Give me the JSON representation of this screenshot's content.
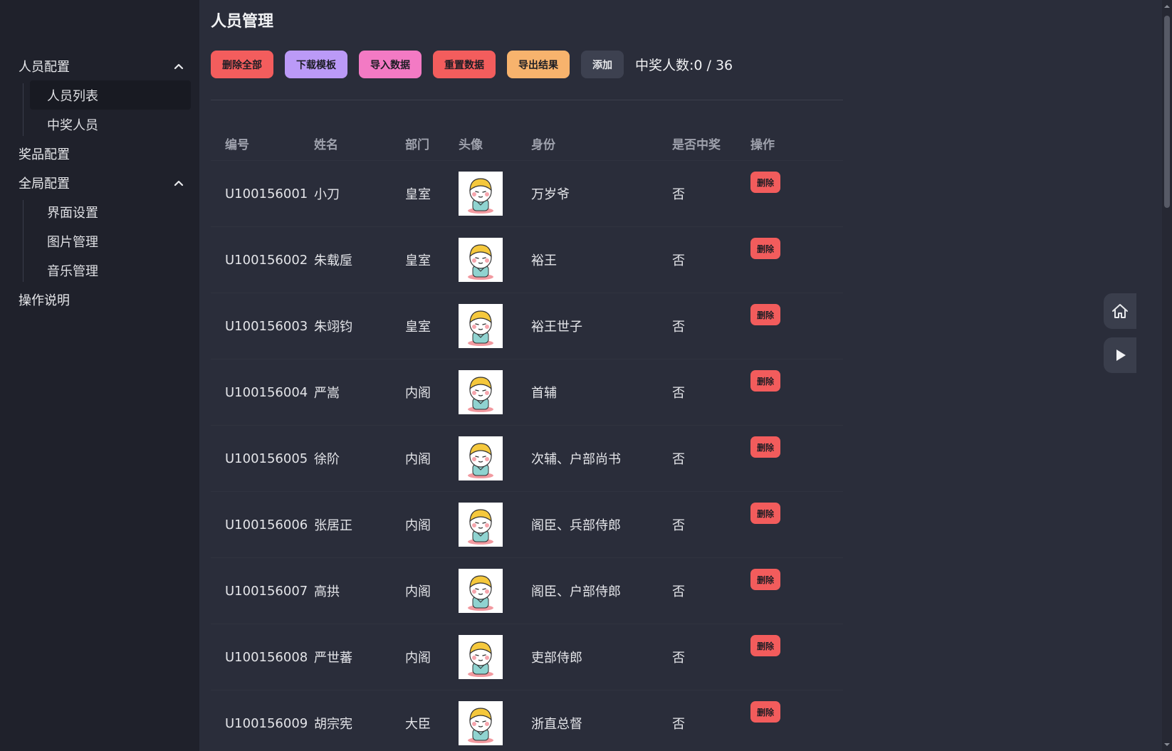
{
  "sidebar": {
    "groups": [
      {
        "label": "人员配置",
        "expanded": true,
        "children": [
          "人员列表",
          "中奖人员"
        ]
      },
      {
        "label": "奖品配置"
      },
      {
        "label": "全局配置",
        "expanded": true,
        "children": [
          "界面设置",
          "图片管理",
          "音乐管理"
        ]
      },
      {
        "label": "操作说明"
      }
    ],
    "active_item": "人员列表"
  },
  "page": {
    "title": "人员管理"
  },
  "toolbar": {
    "delete_all": "删除全部",
    "download_template": "下载模板",
    "import_data": "导入数据",
    "reset_data": "重置数据",
    "export_result": "导出结果",
    "add": "添加",
    "win_count": "中奖人数:0 / 36"
  },
  "table": {
    "headers": [
      "编号",
      "姓名",
      "部门",
      "头像",
      "身份",
      "是否中奖",
      "操作"
    ],
    "delete_label": "删除",
    "rows": [
      {
        "id": "U100156001",
        "name": "小刀",
        "dept": "皇室",
        "role": "万岁爷",
        "won": "否"
      },
      {
        "id": "U100156002",
        "name": "朱载垕",
        "dept": "皇室",
        "role": "裕王",
        "won": "否"
      },
      {
        "id": "U100156003",
        "name": "朱翊钧",
        "dept": "皇室",
        "role": "裕王世子",
        "won": "否"
      },
      {
        "id": "U100156004",
        "name": "严嵩",
        "dept": "内阁",
        "role": "首辅",
        "won": "否"
      },
      {
        "id": "U100156005",
        "name": "徐阶",
        "dept": "内阁",
        "role": "次辅、户部尚书",
        "won": "否"
      },
      {
        "id": "U100156006",
        "name": "张居正",
        "dept": "内阁",
        "role": "阁臣、兵部侍郎",
        "won": "否"
      },
      {
        "id": "U100156007",
        "name": "高拱",
        "dept": "内阁",
        "role": "阁臣、户部侍郎",
        "won": "否"
      },
      {
        "id": "U100156008",
        "name": "严世蕃",
        "dept": "内阁",
        "role": "吏部侍郎",
        "won": "否"
      },
      {
        "id": "U100156009",
        "name": "胡宗宪",
        "dept": "大臣",
        "role": "浙直总督",
        "won": "否"
      }
    ]
  },
  "icons": {
    "home": "home-icon",
    "play": "play-icon",
    "avatar": "cartoon-avatar-icon"
  },
  "colors": {
    "danger": "#f35d5d",
    "purple": "#bb9af7",
    "pink": "#f37ac4",
    "orange": "#f7b36d",
    "background": "#2a2d3a",
    "sidebar": "#1f212b"
  }
}
